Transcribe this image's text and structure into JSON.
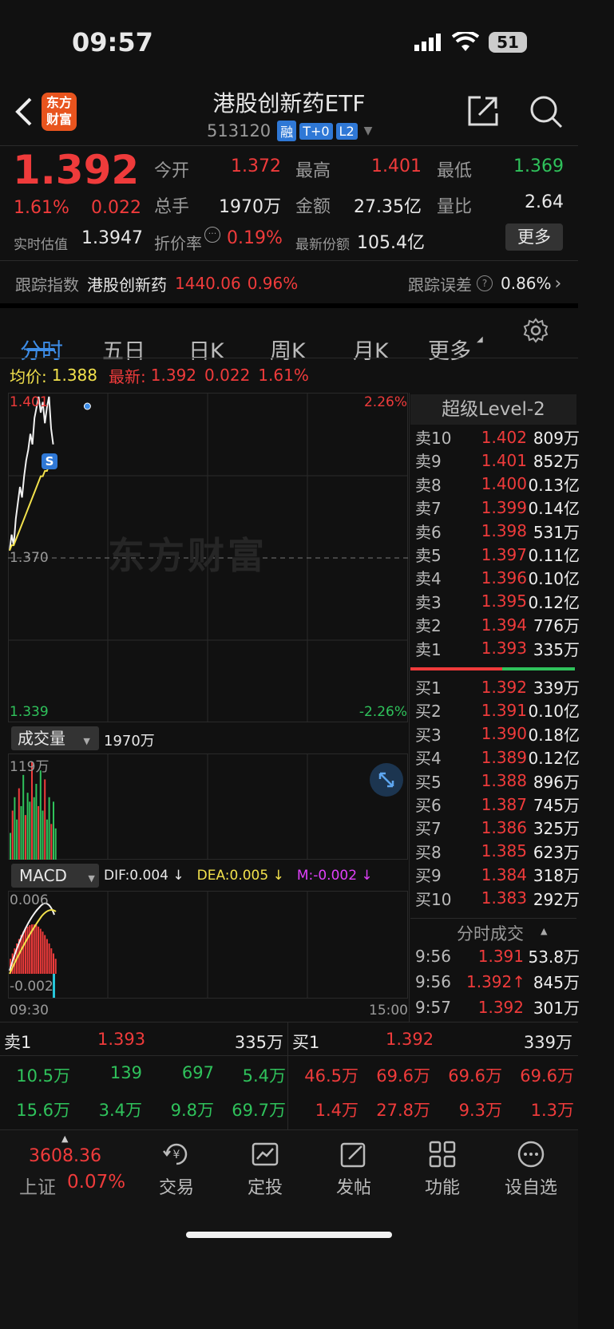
{
  "status_bar": {
    "time": "09:57",
    "battery": "51"
  },
  "header": {
    "title": "港股创新药ETF",
    "code": "513120",
    "badges": [
      "融",
      "T+0",
      "L2"
    ],
    "logo_text": "东方\n财富"
  },
  "quote": {
    "price": "1.392",
    "change_pct": "1.61%",
    "change": "0.022",
    "fields": [
      {
        "label": "今开",
        "value": "1.372",
        "color": "red"
      },
      {
        "label": "最高",
        "value": "1.401",
        "color": "red"
      },
      {
        "label": "最低",
        "value": "1.369",
        "color": "green"
      },
      {
        "label": "总手",
        "value": "1970万",
        "color": "white"
      },
      {
        "label": "金额",
        "value": "27.35亿",
        "color": "white"
      },
      {
        "label": "量比",
        "value": "2.64",
        "color": "white"
      }
    ],
    "iopv_label": "实时估值",
    "iopv_value": "1.3947",
    "discount_label": "折价率",
    "discount_value": "0.19%",
    "shares_label": "最新份额",
    "shares_value": "105.4亿",
    "more_button": "更多"
  },
  "tracking": {
    "label": "跟踪指数",
    "index_name": "港股创新药",
    "index_value": "1440.06",
    "index_pct": "0.96%",
    "error_label": "跟踪误差",
    "error_value": "0.86%"
  },
  "tabs": [
    "分时",
    "五日",
    "日K",
    "周K",
    "月K",
    "更多"
  ],
  "chart_header": {
    "avg_label": "均价:",
    "avg_value": "1.388",
    "latest_label": "最新:",
    "latest_value": "1.392",
    "latest_change": "0.022",
    "latest_pct": "1.61%"
  },
  "chart_data": {
    "type": "line",
    "title": "",
    "ylim": [
      1.339,
      1.401
    ],
    "y_ticks": {
      "top": "1.401",
      "mid": "1.370",
      "bottom": "1.339"
    },
    "pct_ticks": {
      "top": "2.26%",
      "bottom": "-2.26%"
    },
    "x_ticks": [
      "09:30",
      "15:00"
    ],
    "watermark": "东方财富",
    "series": [
      {
        "values": [
          1.372,
          1.375,
          1.373,
          1.378,
          1.381,
          1.384,
          1.382,
          1.386,
          1.389,
          1.391,
          1.394,
          1.392,
          1.397,
          1.399,
          1.401,
          1.398,
          1.4,
          1.396,
          1.399,
          1.401,
          1.395,
          1.392
        ]
      },
      {
        "values": [
          1.372,
          1.373,
          1.373,
          1.374,
          1.375,
          1.376,
          1.377,
          1.378,
          1.379,
          1.38,
          1.381,
          1.382,
          1.383,
          1.384,
          1.385,
          1.386,
          1.386,
          1.387,
          1.387,
          1.388,
          1.388,
          1.388
        ]
      }
    ],
    "volume": {
      "label": "成交量",
      "total": "1970万",
      "max_label": "119万",
      "values": [
        30,
        55,
        70,
        45,
        80,
        60,
        95,
        50,
        75,
        65,
        110,
        70,
        85,
        60,
        100,
        55,
        90,
        45,
        70,
        40,
        65,
        35
      ]
    },
    "macd": {
      "label": "MACD",
      "dif": "DIF:0.004 ↓",
      "dea": "DEA:0.005 ↓",
      "m": "M:-0.002 ↓",
      "top_label": "0.006",
      "bottom_label": "-0.002"
    }
  },
  "order_book": {
    "title": "超级Level-2",
    "asks": [
      {
        "label": "卖10",
        "price": "1.402",
        "vol": "809万"
      },
      {
        "label": "卖9",
        "price": "1.401",
        "vol": "852万"
      },
      {
        "label": "卖8",
        "price": "1.400",
        "vol": "0.13亿"
      },
      {
        "label": "卖7",
        "price": "1.399",
        "vol": "0.14亿"
      },
      {
        "label": "卖6",
        "price": "1.398",
        "vol": "531万"
      },
      {
        "label": "卖5",
        "price": "1.397",
        "vol": "0.11亿"
      },
      {
        "label": "卖4",
        "price": "1.396",
        "vol": "0.10亿"
      },
      {
        "label": "卖3",
        "price": "1.395",
        "vol": "0.12亿"
      },
      {
        "label": "卖2",
        "price": "1.394",
        "vol": "776万"
      },
      {
        "label": "卖1",
        "price": "1.393",
        "vol": "335万"
      }
    ],
    "bids": [
      {
        "label": "买1",
        "price": "1.392",
        "vol": "339万"
      },
      {
        "label": "买2",
        "price": "1.391",
        "vol": "0.10亿"
      },
      {
        "label": "买3",
        "price": "1.390",
        "vol": "0.18亿"
      },
      {
        "label": "买4",
        "price": "1.389",
        "vol": "0.12亿"
      },
      {
        "label": "买5",
        "price": "1.388",
        "vol": "896万"
      },
      {
        "label": "买6",
        "price": "1.387",
        "vol": "745万"
      },
      {
        "label": "买7",
        "price": "1.386",
        "vol": "325万"
      },
      {
        "label": "买8",
        "price": "1.385",
        "vol": "623万"
      },
      {
        "label": "买9",
        "price": "1.384",
        "vol": "318万"
      },
      {
        "label": "买10",
        "price": "1.383",
        "vol": "292万"
      }
    ]
  },
  "ticks": {
    "title": "分时成交",
    "rows": [
      {
        "time": "9:56",
        "price": "1.391",
        "vol": "53.8万",
        "color": "green"
      },
      {
        "time": "9:56",
        "price": "1.392↑",
        "vol": "845万",
        "color": "red"
      },
      {
        "time": "9:57",
        "price": "1.392",
        "vol": "301万",
        "color": "red"
      }
    ]
  },
  "queue": {
    "sell_label": "卖1",
    "sell_price": "1.393",
    "sell_vol": "335万",
    "buy_label": "买1",
    "buy_price": "1.392",
    "buy_vol": "339万",
    "sell_row1": [
      "10.5万",
      "139",
      "697",
      "5.4万"
    ],
    "sell_row2": [
      "15.6万",
      "3.4万",
      "9.8万",
      "69.7万"
    ],
    "buy_row1": [
      "46.5万",
      "69.6万",
      "69.6万",
      "69.6万"
    ],
    "buy_row2": [
      "1.4万",
      "27.8万",
      "9.3万",
      "1.3万"
    ]
  },
  "bottom_nav": {
    "index_value": "3608.36",
    "index_name": "上证",
    "index_pct": "0.07%",
    "items": [
      {
        "label": "交易",
        "icon": "trade-icon"
      },
      {
        "label": "定投",
        "icon": "invest-icon"
      },
      {
        "label": "发帖",
        "icon": "post-icon"
      },
      {
        "label": "功能",
        "icon": "apps-icon"
      },
      {
        "label": "设自选",
        "icon": "favorite-icon"
      }
    ]
  }
}
